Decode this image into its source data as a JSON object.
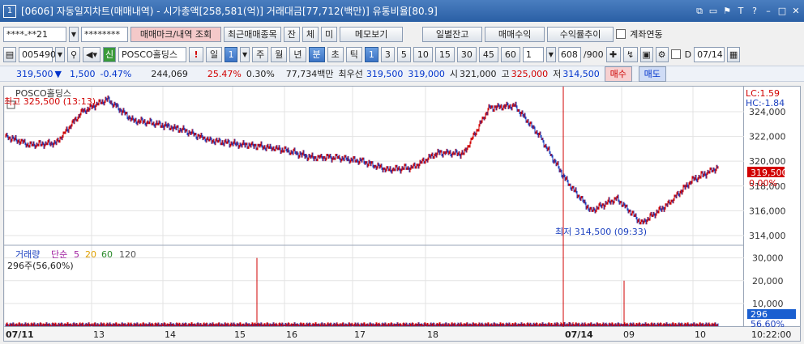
{
  "title": {
    "num": "1",
    "text": "[0606] 자동일지차트(매매내역) - 시가총액[258,581(억)] 거래대금[77,712(백만)] 유통비율[80.9]"
  },
  "toolbar1": {
    "account": "****-**21",
    "password": "********",
    "btn_mark": "매매마크/내역 조회",
    "btn_recent": "최근매매종목",
    "btn_jan": "잔",
    "btn_che": "체",
    "btn_mi": "미",
    "btn_memo": "메모보기",
    "btn_daily": "일별잔고",
    "btn_profit": "매매수익",
    "btn_rate": "수익률추이",
    "chk_account": "계좌연동"
  },
  "toolbar2": {
    "code": "005490",
    "name": "POSCO홀딩스",
    "day": "일",
    "day_val": "1",
    "periods": [
      "주",
      "월",
      "년",
      "분",
      "초",
      "틱"
    ],
    "nums": [
      "1",
      "3",
      "5",
      "10",
      "15",
      "30",
      "45",
      "60"
    ],
    "period_val": "1",
    "count": "608",
    "count_total": "/900",
    "date": "07/14",
    "d_label": "D"
  },
  "quote": {
    "price": "319,500",
    "arrow": "▼",
    "change": "1,500",
    "rate": "-0.47%",
    "volume": "244,069",
    "vol_rate": "25.47%",
    "turnover_rate": "0.30%",
    "amount": "77,734백만",
    "pref_label": "최우선",
    "pref1": "319,500",
    "pref2": "319,000",
    "open_label": "시",
    "open": "321,000",
    "high_label": "고",
    "high": "325,000",
    "low_label": "저",
    "low": "314,500",
    "buy": "매수",
    "sell": "매도"
  },
  "price_panel": {
    "legend": "POSCO홀딩스",
    "lc": "LC:1.59",
    "hc": "HC:-1.84",
    "hi_label": "최고 325,500 (13:13)",
    "lo_label": "최저 314,500 (09:33)",
    "cur_price": "319,500",
    "cur_rate": "0.00%",
    "y_ticks": [
      "324,000",
      "322,000",
      "320,000",
      "318,000",
      "316,000",
      "314,000"
    ]
  },
  "volume_panel": {
    "legend": "거래량",
    "ma_label": "단순",
    "ma": [
      "5",
      "20",
      "60",
      "120"
    ],
    "info": "296주(56,60%)",
    "y_ticks": [
      "30,000",
      "20,000",
      "10,000"
    ],
    "cur": "296",
    "cur_rate": "56.60%"
  },
  "x_labels": [
    "07/11",
    "13",
    "14",
    "15",
    "16",
    "17",
    "18",
    "07/14",
    "09",
    "10"
  ],
  "time": "10:22:00",
  "colors": {
    "up": "#d10000",
    "down": "#1a3fbf",
    "title": "#2a5fa5"
  },
  "chart_data": {
    "type": "candlestick",
    "x_dates": [
      "07/11",
      "07/14"
    ],
    "price_close": [
      322000,
      321300,
      321500,
      324000,
      325000,
      323300,
      323000,
      322500,
      321700,
      321400,
      321200,
      320900,
      320300,
      320300,
      320000,
      319300,
      319500,
      320700,
      320600,
      324300,
      324500,
      322000,
      318500,
      316000,
      317000,
      315000,
      316500,
      318500,
      319500
    ],
    "volume_peaks": [
      30000,
      20000
    ],
    "ylim_price": [
      314000,
      325500
    ],
    "ylim_volume": [
      0,
      32000
    ]
  }
}
